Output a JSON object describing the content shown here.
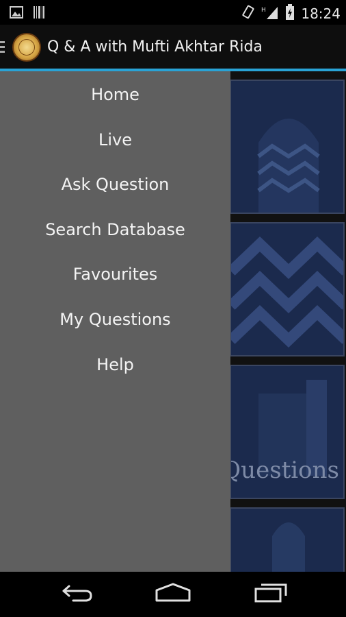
{
  "status_bar": {
    "time": "18:24",
    "icons": [
      "gallery-icon",
      "barcode-icon",
      "rotation-lock-icon",
      "signal-h-icon",
      "battery-charging-icon"
    ]
  },
  "action_bar": {
    "title": "Q & A with Mufti Akhtar Rida",
    "accent_color": "#29a3d6"
  },
  "drawer": {
    "items": [
      {
        "label": "Home"
      },
      {
        "label": "Live"
      },
      {
        "label": "Ask Question"
      },
      {
        "label": "Search Database"
      },
      {
        "label": "Favourites"
      },
      {
        "label": "My Questions"
      },
      {
        "label": "Help"
      }
    ]
  },
  "content": {
    "tiles": [
      {
        "label": ""
      },
      {
        "label": ""
      },
      {
        "label": "Questions"
      },
      {
        "label": ""
      }
    ]
  },
  "nav_bar": {
    "buttons": [
      "back-icon",
      "home-icon",
      "recents-icon"
    ]
  }
}
